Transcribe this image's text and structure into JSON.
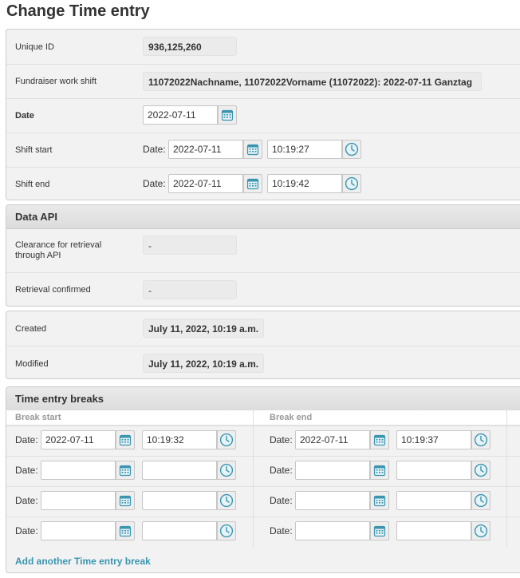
{
  "page": {
    "title": "Change Time entry"
  },
  "main": {
    "unique_id": {
      "label": "Unique ID",
      "value": "936,125,260"
    },
    "work_shift": {
      "label": "Fundraiser work shift",
      "value": "11072022Nachname, 11072022Vorname (11072022): 2022-07-11 Ganztag"
    },
    "date": {
      "label": "Date",
      "value": "2022-07-11"
    },
    "shift_start": {
      "label": "Shift start",
      "date_prefix": "Date:",
      "date": "2022-07-11",
      "time": "10:19:27"
    },
    "shift_end": {
      "label": "Shift end",
      "date_prefix": "Date:",
      "date": "2022-07-11",
      "time": "10:19:42"
    }
  },
  "data_api": {
    "title": "Data API",
    "clearance": {
      "label": "Clearance for retrieval through API",
      "value": "-"
    },
    "retrieval": {
      "label": "Retrieval confirmed",
      "value": "-"
    }
  },
  "meta": {
    "created": {
      "label": "Created",
      "value": "July 11, 2022, 10:19 a.m."
    },
    "modified": {
      "label": "Modified",
      "value": "July 11, 2022, 10:19 a.m."
    }
  },
  "breaks": {
    "title": "Time entry breaks",
    "col_start": "Break start",
    "col_end": "Break end",
    "date_prefix": "Date:",
    "rows": [
      {
        "start_date": "2022-07-11",
        "start_time": "10:19:32",
        "end_date": "2022-07-11",
        "end_time": "10:19:37"
      },
      {
        "start_date": "",
        "start_time": "",
        "end_date": "",
        "end_time": ""
      },
      {
        "start_date": "",
        "start_time": "",
        "end_date": "",
        "end_time": ""
      },
      {
        "start_date": "",
        "start_time": "",
        "end_date": "",
        "end_time": ""
      }
    ],
    "add_link": "Add another Time entry break"
  },
  "colors": {
    "icon": "#3a95b0",
    "link": "#3a95b0",
    "header_bg": "#dcdcdc",
    "module_bg": "#f2f2f2"
  },
  "icons": {
    "calendar": "calendar-icon",
    "clock": "clock-icon"
  }
}
